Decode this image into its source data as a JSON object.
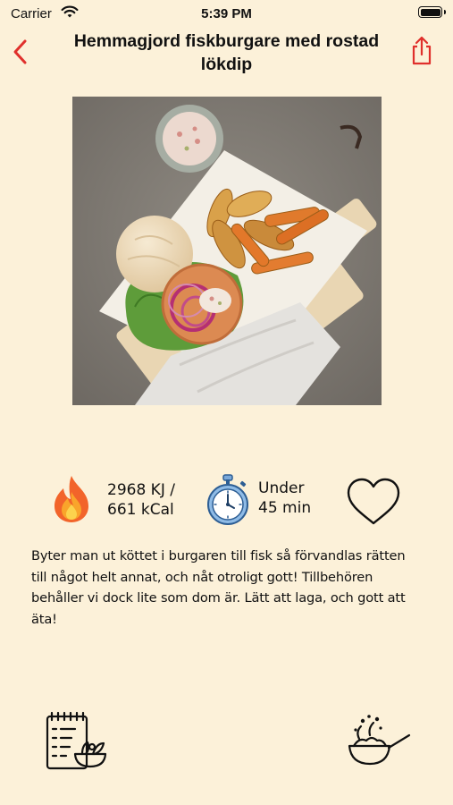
{
  "status_bar": {
    "carrier": "Carrier",
    "time": "5:39 PM",
    "battery_level": 1.0
  },
  "nav": {
    "back_icon": "chevron-left-icon",
    "title": "Hemmagjord fiskburgare med rostad lökdip",
    "share_icon": "share-icon"
  },
  "hero_image": {
    "subject": "fish-burger-with-sweet-potato-wedges-and-onion-dip"
  },
  "stats": {
    "energy_line1": "2968 KJ /",
    "energy_line2": "661 kCal",
    "time_line1": "Under",
    "time_line2": "45 min",
    "fire_icon": "fire-icon",
    "timer_icon": "stopwatch-icon",
    "favorite_icon": "heart-outline-icon"
  },
  "description": "Byter man ut köttet i burgaren till fisk så förvandlas rätten till något helt annat, och nåt otroligt gott! Tillbehören behåller vi dock lite som dom är. Lätt att laga, och gott att äta!",
  "bottom_bar": {
    "ingredients_icon": "ingredients-list-icon",
    "cooking_icon": "wok-cooking-icon"
  },
  "colors": {
    "accent": "#e0302c",
    "background": "#fcf1d9"
  }
}
